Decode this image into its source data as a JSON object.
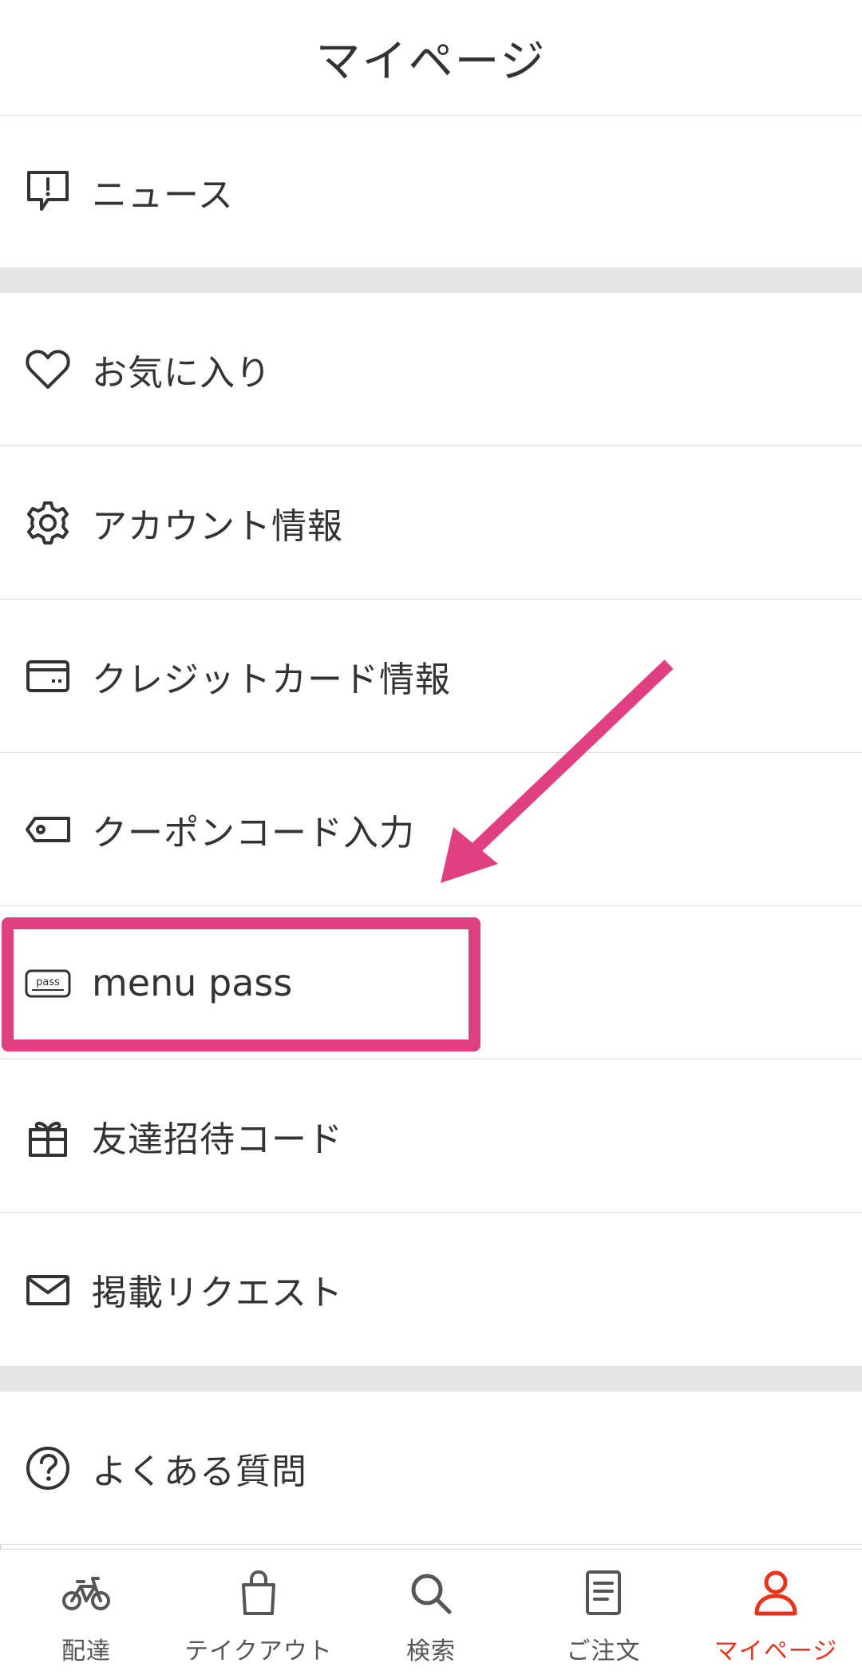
{
  "header": {
    "title": "マイページ"
  },
  "menu": {
    "news": "ニュース",
    "favorites": "お気に入り",
    "account": "アカウント情報",
    "credit_card": "クレジットカード情報",
    "coupon": "クーポンコード入力",
    "menu_pass": "menu pass",
    "referral": "友達招待コード",
    "request": "掲載リクエスト",
    "faq": "よくある質問"
  },
  "tabbar": {
    "delivery": "配達",
    "takeout": "テイクアウト",
    "search": "検索",
    "orders": "ご注文",
    "mypage": "マイページ"
  },
  "colors": {
    "accent": "#e8341c",
    "highlight": "#e0407f",
    "text": "#333333",
    "separator": "#e5e5e5"
  },
  "icons": {
    "news": "news-alert-icon",
    "favorites": "heart-icon",
    "account": "gear-icon",
    "credit_card": "credit-card-icon",
    "coupon": "coupon-tag-icon",
    "menu_pass": "pass-card-icon",
    "referral": "gift-icon",
    "request": "envelope-icon",
    "faq": "question-circle-icon",
    "tab_delivery": "bicycle-icon",
    "tab_takeout": "shopping-bag-icon",
    "tab_search": "search-icon",
    "tab_orders": "document-icon",
    "tab_mypage": "user-icon"
  }
}
